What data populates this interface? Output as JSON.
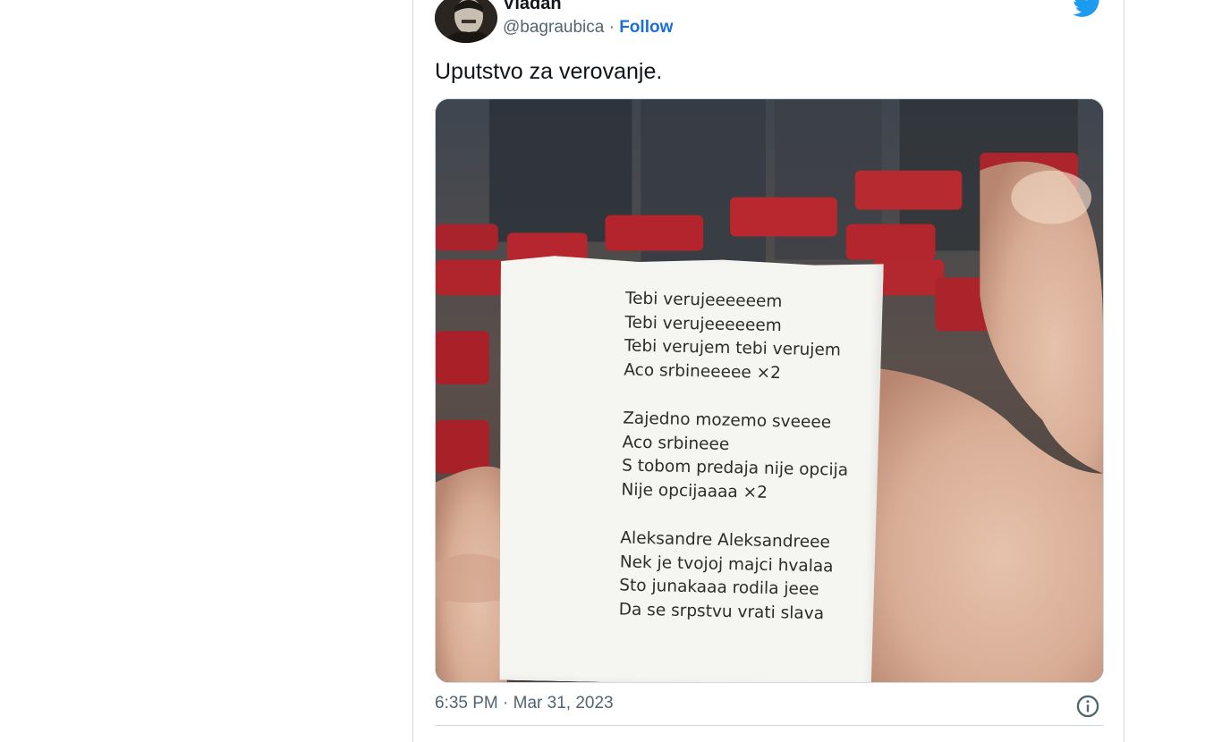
{
  "tweet": {
    "author_name": "Vladan",
    "handle": "@bagraubica",
    "separator": " · ",
    "follow_label": "Follow",
    "text": "Uputstvo za verovanje.",
    "timestamp": "6:35 PM · Mar 31, 2023"
  },
  "note": {
    "stanza1": [
      "Tebi verujeeeeeem",
      "Tebi verujeeeeeem",
      "Tebi verujem tebi verujem",
      "Aco srbineeeee    ×2"
    ],
    "stanza2": [
      "Zajedno mozemo sveeee",
      "Aco srbineee",
      "S tobom predaja nije opcija",
      "Nije opcijaaaa   ×2"
    ],
    "stanza3": [
      "Aleksandre Aleksandreee",
      "Nek je tvojoj majci hvalaa",
      "Sto junakaaa rodila jeee",
      "Da se srpstvu vrati slava"
    ]
  },
  "icons": {
    "brand": "twitter-bird-icon",
    "info": "info-icon"
  },
  "colors": {
    "accent": "#1d9bf0",
    "follow": "#1d6fd6",
    "muted": "#536471",
    "text": "#0f1419"
  }
}
